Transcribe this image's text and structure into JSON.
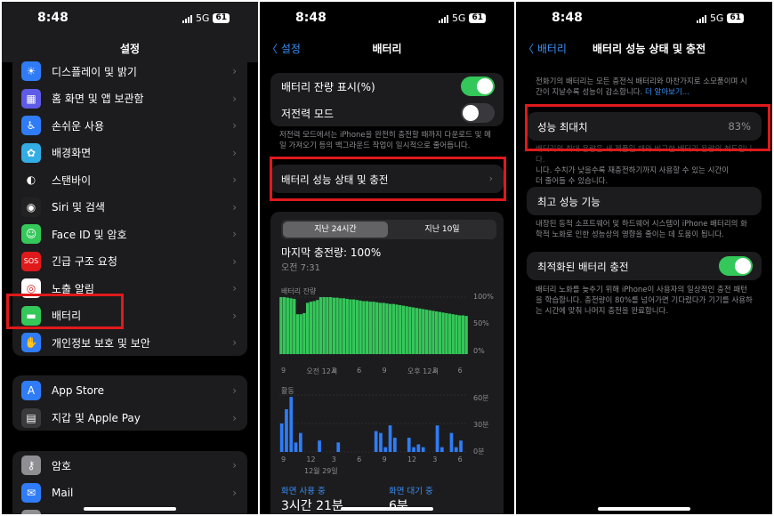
{
  "status": {
    "time": "8:48",
    "network": "5G",
    "battery": "61"
  },
  "panel1": {
    "title": "설정",
    "group1": [
      {
        "label": "디스플레이 및 밝기",
        "icon": "sun-icon",
        "color": "#2f7cf6"
      },
      {
        "label": "홈 화면 및 앱 보관함",
        "icon": "grid-icon",
        "color": "#5e5ce6"
      },
      {
        "label": "손쉬운 사용",
        "icon": "accessibility-icon",
        "color": "#2f7cf6"
      },
      {
        "label": "배경화면",
        "icon": "flower-icon",
        "color": "#32ade6"
      },
      {
        "label": "스탠바이",
        "icon": "standby-icon",
        "color": "#1c1c1e"
      },
      {
        "label": "Siri 및 검색",
        "icon": "siri-icon",
        "color": "#222"
      },
      {
        "label": "Face ID 및 암호",
        "icon": "faceid-icon",
        "color": "#34c759"
      },
      {
        "label": "긴급 구조 요청",
        "icon": "sos-icon",
        "color": "#e0191b"
      },
      {
        "label": "노출 알림",
        "icon": "exposure-icon",
        "color": "#fff"
      },
      {
        "label": "배터리",
        "icon": "battery-icon",
        "color": "#34c759"
      },
      {
        "label": "개인정보 보호 및 보안",
        "icon": "hand-icon",
        "color": "#2f7cf6"
      }
    ],
    "group2": [
      {
        "label": "App Store",
        "icon": "appstore-icon",
        "color": "#2f7cf6"
      },
      {
        "label": "지갑 및 Apple Pay",
        "icon": "wallet-icon",
        "color": "#3a3a3c"
      }
    ],
    "group3": [
      {
        "label": "암호",
        "icon": "key-icon",
        "color": "#8e8e93"
      },
      {
        "label": "Mail",
        "icon": "mail-icon",
        "color": "#2f7cf6"
      },
      {
        "label": "연락처",
        "icon": "contacts-icon",
        "color": "#8e8e93"
      }
    ]
  },
  "panel2": {
    "back": "설정",
    "title": "배터리",
    "toggle1": "배터리 잔량 표시(%)",
    "toggle2": "저전력 모드",
    "lowpower_note": "저전력 모드에서는 iPhone을 완전히 충전할 때까지 다운로드 및 메일 가져오기 등의 백그라운드 작업이 일시적으로 줄어듭니다.",
    "health_link": "배터리 성능 상태 및 충전",
    "seg1": "지난 24시간",
    "seg2": "지난 10일",
    "last_charge": "마지막 충전량: 100%",
    "last_charge_time": "오전 7:31",
    "level_label": "배터리 잔량",
    "level_ticks": [
      "100%",
      "50%",
      "0%"
    ],
    "x_ticks": [
      "9",
      "오전 12시",
      "3",
      "6",
      "9",
      "오후 12시",
      "3",
      "6"
    ],
    "activity_label": "활동",
    "activity_ticks": [
      "60분",
      "30분",
      "0분"
    ],
    "x_ticks2": [
      "9",
      "12",
      "3",
      "6",
      "9",
      "12",
      "3",
      "6"
    ],
    "date_label": "12월 29일",
    "screen_on_label": "화면 사용 중",
    "screen_on_value": "3시간 21분",
    "screen_off_label": "화면 대기 중",
    "screen_off_value": "6분"
  },
  "panel3": {
    "back": "배터리",
    "title": "배터리 성능 상태 및 충전",
    "intro": "전화기의 배터리는 모든 충전식 배터리와 마찬가지로 소모품이며 시간이 지날수록 성능이 감소합니다.",
    "learn_more": "더 알아보기...",
    "max_capacity_label": "성능 최대치",
    "max_capacity_value": "83%",
    "capacity_note_line1": "배터리의 최대 용량은 새 제품일 때와 비교한 배터리 용량의 척도입니다.",
    "capacity_note_line2": "니다. 수치가 낮을수록 재충전하기까지 사용할 수 있는 시간이",
    "capacity_note_line3": "더 줄어들 수 있습니다.",
    "peak_label": "최고 성능 기능",
    "peak_note": "내장된 동적 소프트웨어 및 하드웨어 시스템이 iPhone 배터리의 화학적 노화로 인한 성능상의 영향을 줄이는 데 도움이 됩니다.",
    "opt_label": "최적화된 배터리 충전",
    "opt_note": "배터리 노화를 늦추기 위해 iPhone이 사용자의 일상적인 충전 패턴을 학습합니다. 충전량이 80%를 넘어가면 기다렸다가 기기를 사용하는 시간에 맞춰 나머지 충전을 완료합니다."
  },
  "chart_data": [
    {
      "type": "bar",
      "title": "배터리 잔량",
      "ylim": [
        0,
        100
      ],
      "values": [
        100,
        100,
        99,
        98,
        97,
        70,
        70,
        72,
        90,
        92,
        93,
        95,
        100,
        100,
        100,
        100,
        99,
        99,
        98,
        98,
        97,
        96,
        96,
        95,
        94,
        93,
        93,
        92,
        92,
        91,
        90,
        90,
        89,
        88,
        88,
        87,
        86,
        85,
        84,
        83,
        82,
        81,
        80,
        79,
        78,
        77,
        76,
        75,
        74,
        73,
        72,
        71,
        70,
        69,
        68,
        68,
        67
      ]
    },
    {
      "type": "bar",
      "title": "활동",
      "ylim": [
        0,
        60
      ],
      "values": [
        30,
        45,
        58,
        10,
        20,
        0,
        0,
        0,
        12,
        0,
        0,
        0,
        10,
        0,
        0,
        0,
        0,
        0,
        0,
        0,
        22,
        20,
        5,
        28,
        15,
        0,
        0,
        15,
        5,
        8,
        5,
        0,
        0,
        28,
        5,
        0,
        20,
        5,
        12,
        0
      ]
    }
  ]
}
